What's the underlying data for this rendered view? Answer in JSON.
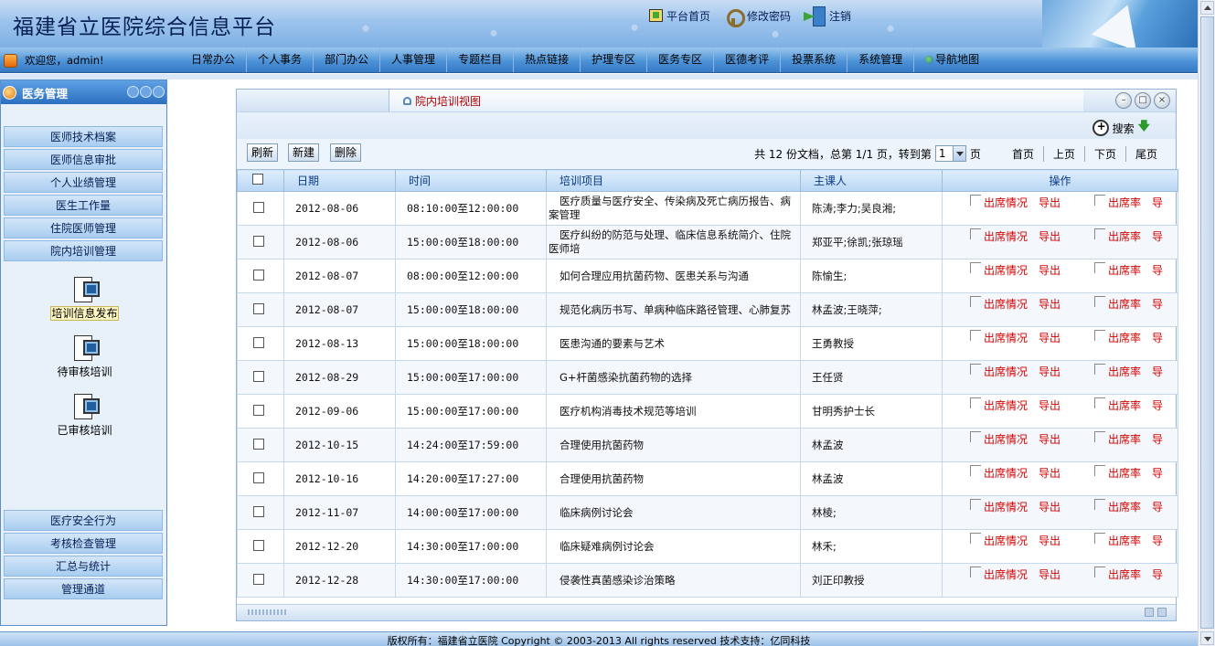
{
  "header": {
    "title": "福建省立医院综合信息平台",
    "links": [
      "平台首页",
      "修改密码",
      "注销"
    ]
  },
  "nav": {
    "welcome": "欢迎您，admin!",
    "menu": [
      "日常办公",
      "个人事务",
      "部门办公",
      "人事管理",
      "专题栏目",
      "热点链接",
      "护理专区",
      "医务专区",
      "医德考评",
      "投票系统",
      "系统管理"
    ],
    "map": "导航地图"
  },
  "sidebar": {
    "title": "医务管理",
    "groups_top": [
      "医师技术档案",
      "医师信息审批",
      "个人业绩管理",
      "医生工作量",
      "住院医师管理",
      "院内培训管理"
    ],
    "tools": [
      "培训信息发布",
      "待审核培训",
      "已审核培训"
    ],
    "groups_bottom": [
      "医疗安全行为",
      "考核检查管理",
      "汇总与统计",
      "管理通道"
    ]
  },
  "panel": {
    "title": "院内培训视图",
    "search": "搜索",
    "buttons": {
      "refresh": "刷新",
      "new": "新建",
      "delete": "删除"
    },
    "pager": {
      "summary": "共 12 份文档，总第 1/1 页，转到第",
      "page": "1",
      "unit": "页",
      "first": "首页",
      "prev": "上页",
      "next": "下页",
      "last": "尾页"
    },
    "columns": [
      "日期",
      "时间",
      "培训项目",
      "主课人",
      "操作"
    ],
    "op_labels": {
      "attendance": "出席情况",
      "export": "导出",
      "rate": "出席率",
      "export2": "导"
    },
    "rows": [
      {
        "date": "2012-08-06",
        "time": "08:10:00至12:00:00",
        "project": "医疗质量与医疗安全、传染病及死亡病历报告、病案管理",
        "teacher": "陈涛;李力;吴良湘;"
      },
      {
        "date": "2012-08-06",
        "time": "15:00:00至18:00:00",
        "project": "医疗纠纷的防范与处理、临床信息系统简介、住院医师培",
        "teacher": "郑亚平;徐凯;张琼瑶"
      },
      {
        "date": "2012-08-07",
        "time": "08:00:00至12:00:00",
        "project": "如何合理应用抗菌药物、医患关系与沟通",
        "teacher": "陈愉生;"
      },
      {
        "date": "2012-08-07",
        "time": "15:00:00至18:00:00",
        "project": "规范化病历书写、单病种临床路径管理、心肺复苏",
        "teacher": "林孟波;王晓萍;"
      },
      {
        "date": "2012-08-13",
        "time": "15:00:00至18:00:00",
        "project": "医患沟通的要素与艺术",
        "teacher": "王勇教授"
      },
      {
        "date": "2012-08-29",
        "time": "15:00:00至17:00:00",
        "project": "G+杆菌感染抗菌药物的选择",
        "teacher": "王任贤"
      },
      {
        "date": "2012-09-06",
        "time": "15:00:00至17:00:00",
        "project": "医疗机构消毒技术规范等培训",
        "teacher": "甘明秀护士长"
      },
      {
        "date": "2012-10-15",
        "time": "14:24:00至17:59:00",
        "project": "合理使用抗菌药物",
        "teacher": "林孟波"
      },
      {
        "date": "2012-10-16",
        "time": "14:20:00至17:27:00",
        "project": "合理使用抗菌药物",
        "teacher": "林孟波"
      },
      {
        "date": "2012-11-07",
        "time": "14:00:00至17:00:00",
        "project": "临床病例讨论会",
        "teacher": "林棱;"
      },
      {
        "date": "2012-12-20",
        "time": "14:30:00至17:00:00",
        "project": "临床疑难病例讨论会",
        "teacher": "林禾;"
      },
      {
        "date": "2012-12-28",
        "time": "14:30:00至17:00:00",
        "project": "侵袭性真菌感染诊治策略",
        "teacher": "刘正印教授"
      }
    ]
  },
  "footer": "版权所有：福建省立医院  Copyright © 2003-2013 All rights reserved 技术支持：亿同科技"
}
